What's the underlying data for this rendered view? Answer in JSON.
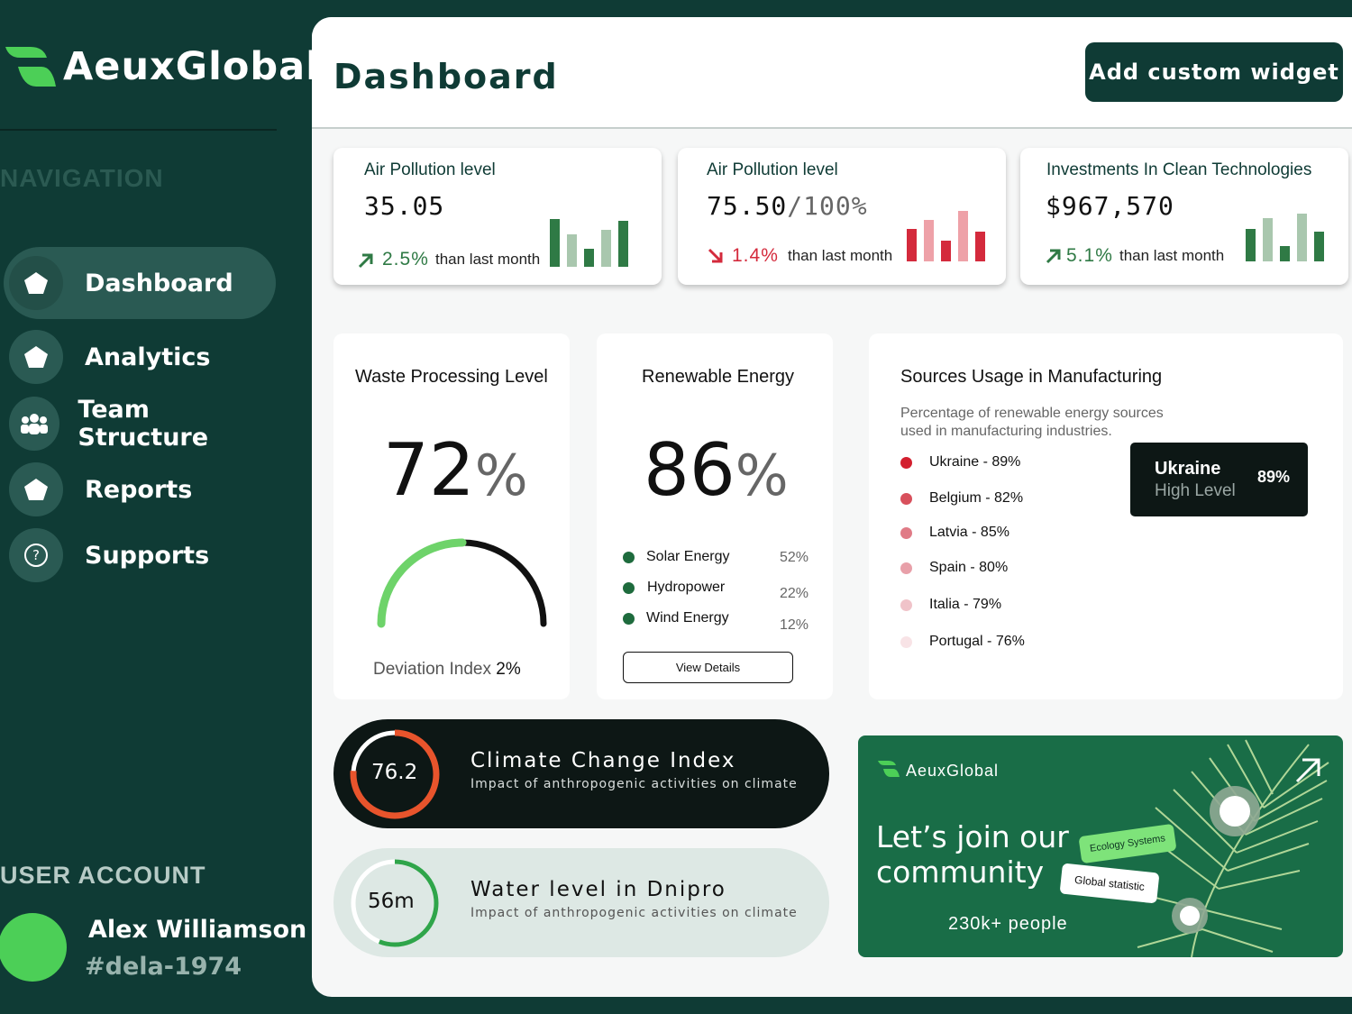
{
  "sidebar": {
    "brand": "AeuxGlobal",
    "nav_heading": "NAVIGATION",
    "items": [
      {
        "label": "Dashboard",
        "icon": "pentagon-icon",
        "active": true
      },
      {
        "label": "Analytics",
        "icon": "pentagon-icon"
      },
      {
        "label": "Team Structure",
        "icon": "team-icon"
      },
      {
        "label": "Reports",
        "icon": "pentagon-icon"
      },
      {
        "label": "Supports",
        "icon": "question-icon"
      }
    ],
    "account_heading": "USER ACCOUNT",
    "user_name": "Alex Williamson",
    "user_id": "#dela-1974"
  },
  "header": {
    "title": "Dashboard",
    "add_widget_label": "Add custom widget"
  },
  "stats": [
    {
      "title": "Air Pollution level",
      "value": "35.05",
      "suffix": "",
      "change": "2.5%",
      "direction": "up",
      "note": "than last month",
      "color": "#2f7a45",
      "bars": [
        0.8,
        0.55,
        0.3,
        0.62,
        0.78
      ],
      "bar_colors": [
        "#2f7a45",
        "#a9c7ae",
        "#2f7a45",
        "#a9c7ae",
        "#2f7a45"
      ]
    },
    {
      "title": "Air Pollution level",
      "value": "75.50",
      "suffix": "/100%",
      "change": "1.4%",
      "direction": "down",
      "note": "than last month",
      "color": "#d42a3c",
      "bars": [
        0.55,
        0.7,
        0.35,
        0.85,
        0.5
      ],
      "bar_colors": [
        "#d42a3c",
        "#eea1a8",
        "#d42a3c",
        "#eea1a8",
        "#d42a3c"
      ]
    },
    {
      "title": "Investments In Clean Technologies",
      "value": "$967,570",
      "suffix": "",
      "change": "5.1%",
      "direction": "up",
      "note": "than last month",
      "color": "#2f7a45",
      "bars": [
        0.55,
        0.72,
        0.25,
        0.8,
        0.5
      ],
      "bar_colors": [
        "#2f7a45",
        "#a9c7ae",
        "#2f7a45",
        "#a9c7ae",
        "#2f7a45"
      ]
    }
  ],
  "waste": {
    "title": "Waste Processing Level",
    "value": "72",
    "unit": "%",
    "progress": 0.5,
    "deviation_label": "Deviation Index",
    "deviation_value": "2%"
  },
  "renewable": {
    "title": "Renewable Energy",
    "value": "86",
    "unit": "%",
    "sources": [
      {
        "label": "Solar Energy",
        "value": "52%"
      },
      {
        "label": "Hydropower",
        "value": "22%"
      },
      {
        "label": "Wind Energy",
        "value": "12%"
      }
    ],
    "button_label": "View Details"
  },
  "sources_usage": {
    "title": "Sources Usage in Manufacturing",
    "subtitle_line1": "Percentage of renewable energy sources",
    "subtitle_line2": "used in manufacturing industries.",
    "countries": [
      {
        "label": "Ukraine - 89%",
        "color": "#d31f2e"
      },
      {
        "label": "Belgium - 82%",
        "color": "#d8505c"
      },
      {
        "label": "Latvia - 85%",
        "color": "#e07b86"
      },
      {
        "label": "Spain - 80%",
        "color": "#e8a0a9"
      },
      {
        "label": "Italia - 79%",
        "color": "#f0c3c9"
      },
      {
        "label": "Portugal - 76%",
        "color": "#f8e3e6"
      }
    ],
    "tooltip": {
      "country": "Ukraine",
      "level": "High Level",
      "value": "89%"
    }
  },
  "climate": {
    "value": "76.2",
    "progress": 0.762,
    "title": "Climate Change Index",
    "subtitle": "Impact of anthropogenic activities on climate"
  },
  "water": {
    "value": "56m",
    "progress": 0.56,
    "title": "Water level in Dnipro",
    "subtitle": "Impact of anthropogenic activities on climate"
  },
  "promo": {
    "brand": "AeuxGlobal",
    "headline_line1": "Let’s join our",
    "headline_line2": "community",
    "people": "230k+ people",
    "tag1": "Ecology Systems",
    "tag2": "Global statistic"
  },
  "colors": {
    "primary": "#0f3b35",
    "accent_green": "#4ccf57",
    "promo_green": "#196d47",
    "alert_red": "#d42a3c",
    "climate_orange": "#e8542c"
  }
}
